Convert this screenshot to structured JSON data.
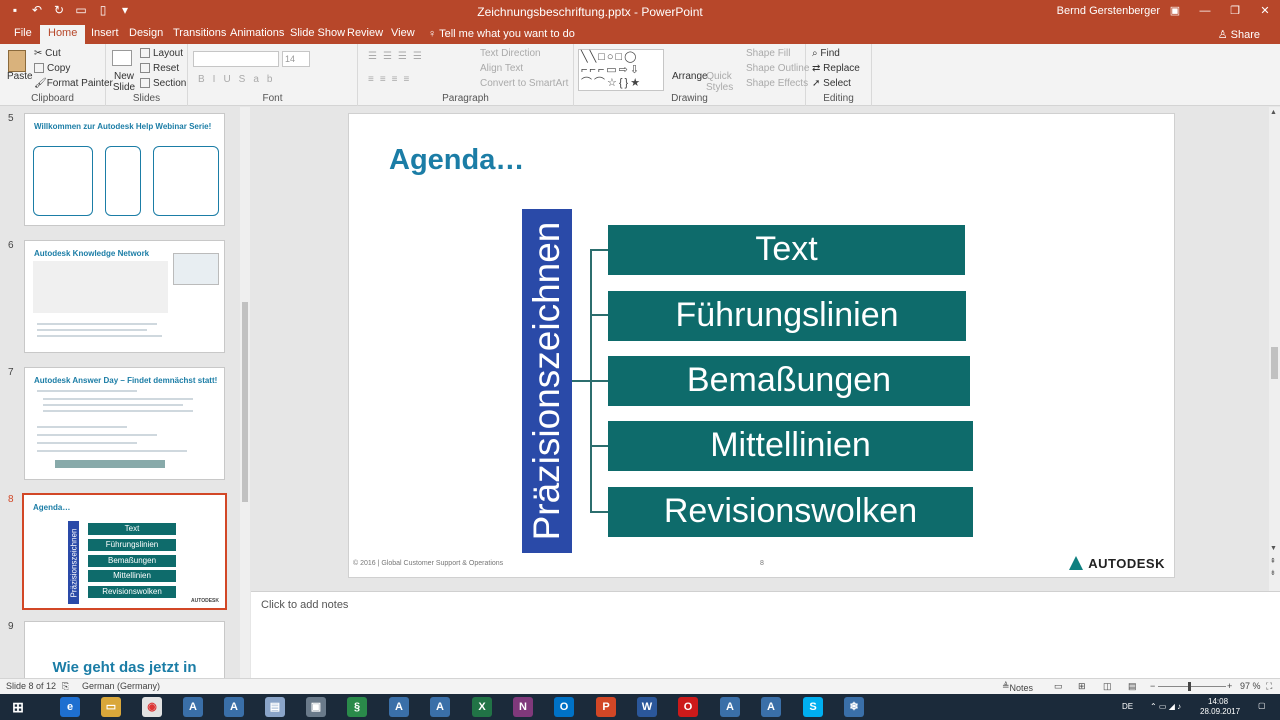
{
  "window": {
    "title": "Zeichnungsbeschriftung.pptx - PowerPoint",
    "user": "Bernd Gerstenberger"
  },
  "tabs": [
    "File",
    "Home",
    "Insert",
    "Design",
    "Transitions",
    "Animations",
    "Slide Show",
    "Review",
    "View"
  ],
  "tell_me": "Tell me what you want to do",
  "share": "Share",
  "ribbon": {
    "clipboard": {
      "label": "Clipboard",
      "paste": "Paste",
      "cut": "Cut",
      "copy": "Copy",
      "format_painter": "Format Painter"
    },
    "slides": {
      "label": "Slides",
      "new_slide": "New Slide",
      "layout": "Layout",
      "reset": "Reset",
      "section": "Section"
    },
    "font": {
      "label": "Font",
      "size": "14"
    },
    "paragraph": {
      "label": "Paragraph",
      "text_direction": "Text Direction",
      "align_text": "Align Text",
      "convert": "Convert to SmartArt"
    },
    "drawing": {
      "label": "Drawing",
      "arrange": "Arrange",
      "quick_styles": "Quick Styles",
      "shape_fill": "Shape Fill",
      "shape_outline": "Shape Outline",
      "shape_effects": "Shape Effects"
    },
    "editing": {
      "label": "Editing",
      "find": "Find",
      "replace": "Replace",
      "select": "Select"
    }
  },
  "thumbnails": [
    {
      "num": "5",
      "title": "Willkommen zur Autodesk Help Webinar Serie!"
    },
    {
      "num": "6",
      "title": "Autodesk Knowledge Network"
    },
    {
      "num": "7",
      "title": "Autodesk Answer Day – Findet demnächst statt!"
    },
    {
      "num": "8",
      "title": "Agenda…"
    },
    {
      "num": "9",
      "title": "Wie geht das jetzt in"
    }
  ],
  "slide": {
    "title": "Agenda…",
    "vertical_label": "Präzisionszeichnen",
    "items": [
      "Text",
      "Führungslinien",
      "Bemaßungen",
      "Mittellinien",
      "Revisionswolken"
    ],
    "footer": "© 2016 | Global Customer Support & Operations",
    "page": "8",
    "logo": "AUTODESK"
  },
  "notes_placeholder": "Click to add notes",
  "status": {
    "slide_of": "Slide 8 of 12",
    "language": "German (Germany)",
    "notes": "Notes",
    "zoom": "97 %"
  },
  "taskbar": {
    "lang": "DE",
    "time": "14:08",
    "date": "28.09.2017"
  }
}
